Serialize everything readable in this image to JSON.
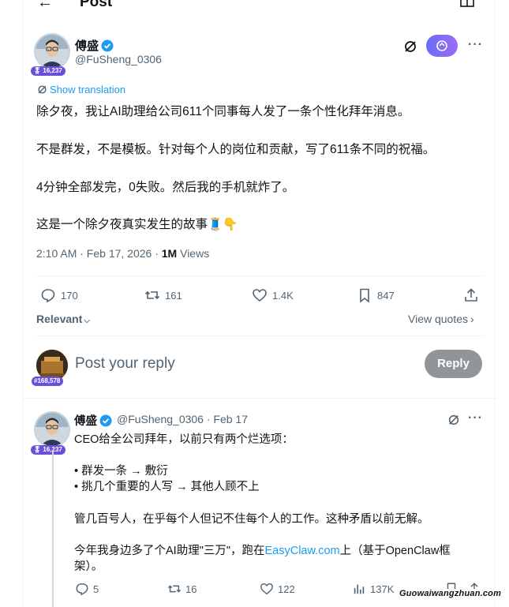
{
  "header": {
    "title": "Post"
  },
  "post": {
    "author_name": "傅盛",
    "author_handle": "@FuSheng_0306",
    "author_badge": "16,237",
    "translate_label": "Show translation",
    "lines": [
      "除夕夜，我让AI助理给公司611个同事每人发了一条个性化拜年消息。",
      "不是群发，不是模板。针对每个人的岗位和贡献，写了611条不同的祝福。",
      "4分钟全部发完，0失败。然后我的手机就炸了。",
      "这是一个除夕夜真实发生的故事🧵👇"
    ],
    "time": "2:10 AM · Feb 17, 2026 · ",
    "views_count": "1M",
    "views_label": " Views",
    "stats": {
      "replies": "170",
      "reposts": "161",
      "likes": "1.4K",
      "bookmarks": "847"
    }
  },
  "sort": {
    "relevant": "Relevant",
    "view_quotes": "View quotes"
  },
  "composer": {
    "placeholder": "Post your reply",
    "badge": "#168,578",
    "button": "Reply"
  },
  "reply": {
    "author_name": "傅盛",
    "handle_date": "@FuSheng_0306 · Feb 17",
    "author_badge": "16,237",
    "lines": [
      "CEO给全公司拜年，以前只有两个烂选项：",
      "• 群发一条 → 敷衍",
      "• 挑几个重要的人写 → 其他人顾不上",
      "管几百号人，在乎每个人但记不住每个人的工作。这种矛盾以前无解。",
      "今年我身边多了个AI助理\"三万\"，跑在",
      "EasyClaw.com",
      "上（基于OpenClaw框",
      "架）。"
    ],
    "stats": {
      "replies": "5",
      "reposts": "16",
      "likes": "122",
      "views": "137K"
    }
  },
  "watermark": "Guowaiwangzhuan.com",
  "colors": {
    "accent": "#1d9bf0",
    "grok_start": "#6b6cf5",
    "grok_end": "#9a6bf5",
    "badge": "#6a4fd8"
  }
}
